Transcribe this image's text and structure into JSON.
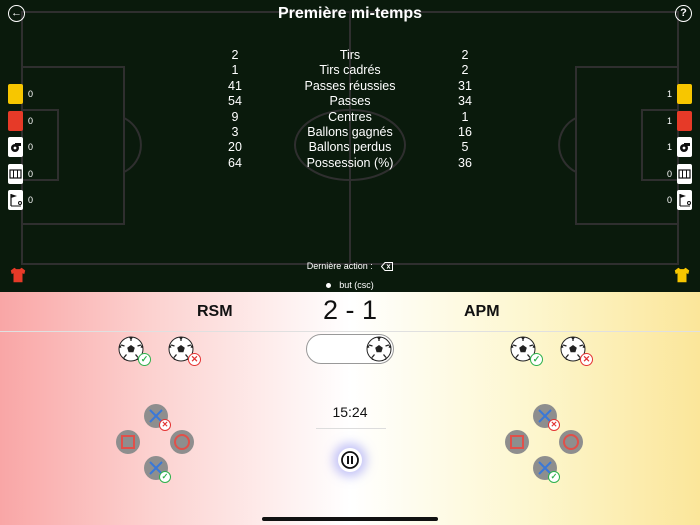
{
  "header": {
    "title": "Première mi-temps",
    "back_icon": "back-arrow-icon",
    "help_icon": "help-icon",
    "back_glyph": "←",
    "help_glyph": "?"
  },
  "stats": [
    {
      "label": "Tirs",
      "home": "2",
      "away": "2"
    },
    {
      "label": "Tirs cadrés",
      "home": "1",
      "away": "2"
    },
    {
      "label": "Passes réussies",
      "home": "41",
      "away": "31"
    },
    {
      "label": "Passes",
      "home": "54",
      "away": "34"
    },
    {
      "label": "Centres",
      "home": "9",
      "away": "1"
    },
    {
      "label": "Ballons gagnés",
      "home": "3",
      "away": "16"
    },
    {
      "label": "Ballons perdus",
      "home": "20",
      "away": "5"
    },
    {
      "label": "Possession (%)",
      "home": "64",
      "away": "36"
    }
  ],
  "cards": {
    "home": [
      {
        "type": "yellow-card",
        "count": "0"
      },
      {
        "type": "red-card",
        "count": "0"
      },
      {
        "type": "whistle",
        "count": "0"
      },
      {
        "type": "goal-net",
        "count": "0"
      },
      {
        "type": "corner-flag",
        "count": "0"
      }
    ],
    "away": [
      {
        "type": "yellow-card",
        "count": "1"
      },
      {
        "type": "red-card",
        "count": "1"
      },
      {
        "type": "whistle",
        "count": "1"
      },
      {
        "type": "goal-net",
        "count": "0"
      },
      {
        "type": "corner-flag",
        "count": "0"
      }
    ]
  },
  "jerseys": {
    "home_color": "#e63a28",
    "away_color": "#f7c600"
  },
  "last_action": {
    "label": "Dernière action :",
    "event": "but (csc)"
  },
  "match": {
    "home_team": "RSM",
    "away_team": "APM",
    "score": "2 - 1",
    "clock": "15:24"
  },
  "colors": {
    "pitch": "#0a1a0c",
    "home_tint": "#f9a6a6",
    "away_tint": "#fbe69a",
    "ok": "#2db14c",
    "ko": "#e33333",
    "pad_symbol": "#3a78d8",
    "pad_shape": "#e0504a"
  },
  "icons": {
    "ball": "soccer-ball-icon",
    "ok_badge": "check-icon",
    "ko_badge": "cross-icon",
    "pause": "pause-icon",
    "check_glyph": "✓",
    "cross_glyph": "✕"
  }
}
